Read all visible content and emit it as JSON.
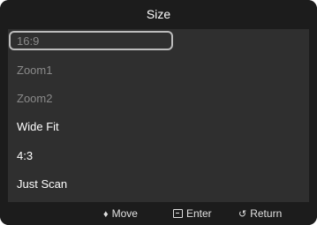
{
  "title": "Size",
  "menu": {
    "items": [
      {
        "label": "16:9",
        "state": "disabled",
        "selected": true
      },
      {
        "label": "Zoom1",
        "state": "disabled",
        "selected": false
      },
      {
        "label": "Zoom2",
        "state": "disabled",
        "selected": false
      },
      {
        "label": "Wide Fit",
        "state": "enabled",
        "selected": false
      },
      {
        "label": "4:3",
        "state": "enabled",
        "selected": false
      },
      {
        "label": "Just Scan",
        "state": "enabled",
        "selected": false
      }
    ]
  },
  "footer": {
    "move": {
      "glyph": "♦",
      "label": "Move"
    },
    "enter": {
      "icon": "enter-icon",
      "label": "Enter"
    },
    "return": {
      "glyph": "↺",
      "label": "Return"
    }
  },
  "colors": {
    "background": "#1c1c1c",
    "panel": "#2f2f2f",
    "text": "#ffffff",
    "disabled_text": "#8a8a8a",
    "selection_border": "#bcbcbc"
  }
}
